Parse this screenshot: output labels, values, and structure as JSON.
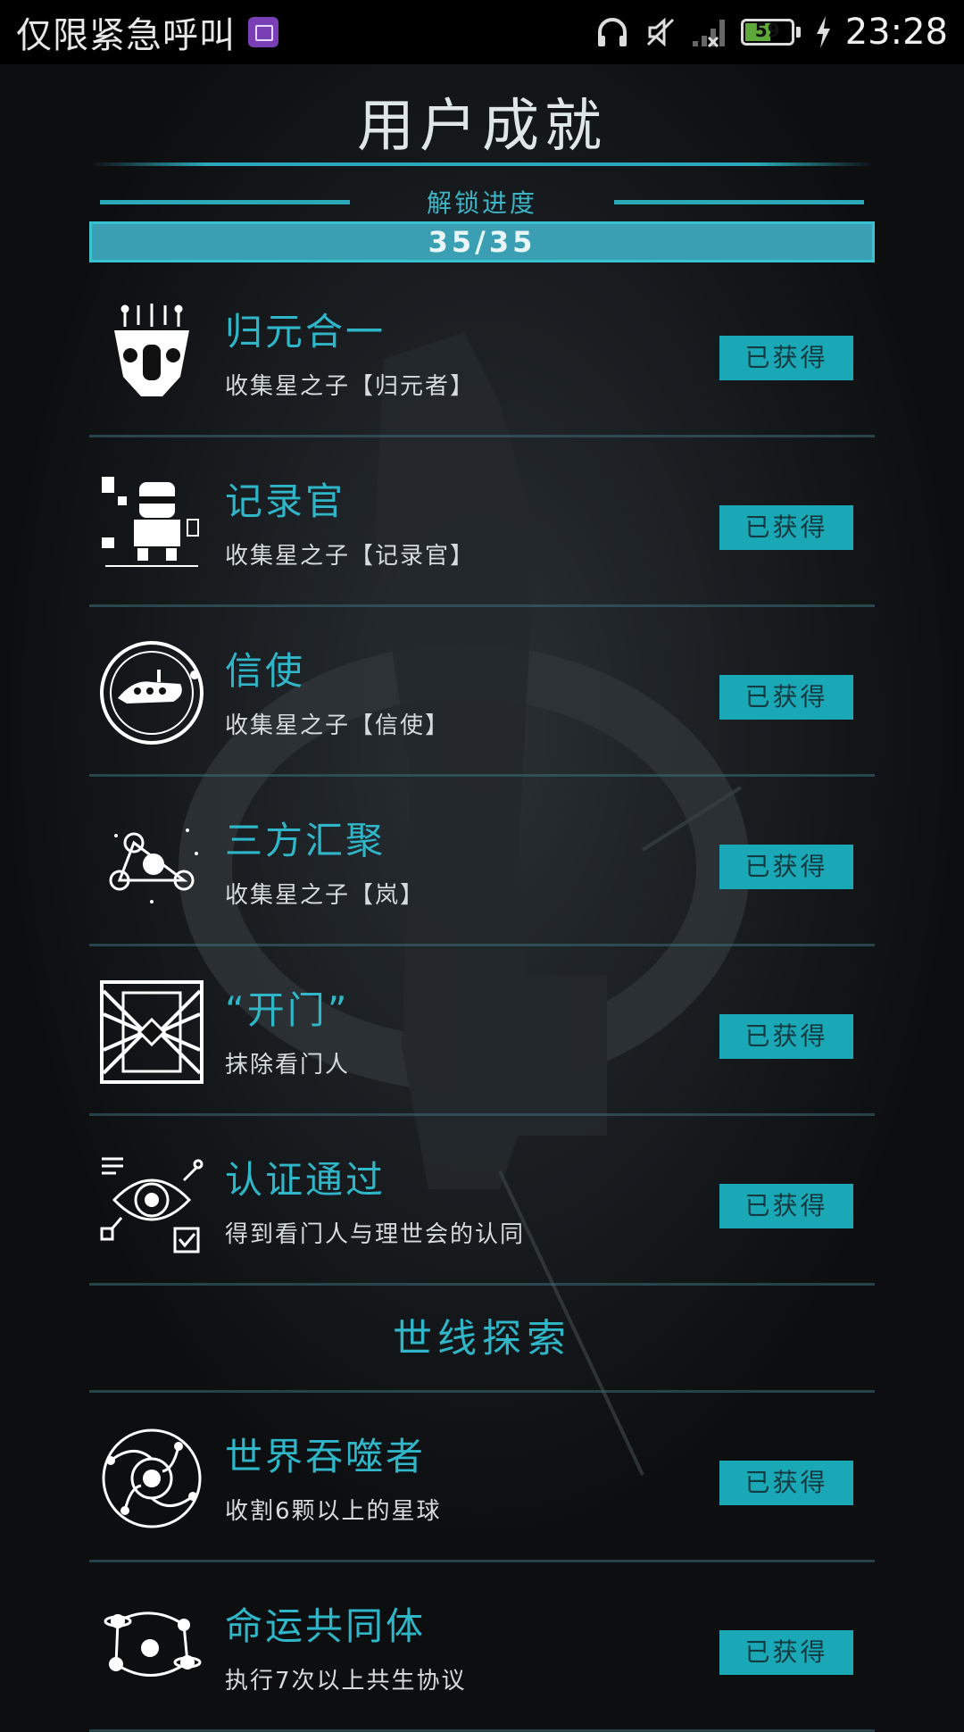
{
  "status_bar": {
    "carrier": "仅限紧急呼叫",
    "battery_level": "59",
    "battery_fraction": 0.59,
    "time": "23:28",
    "icons": [
      "gallery-icon",
      "headphones-icon",
      "mute-icon",
      "signal-icon",
      "battery-icon",
      "charging-icon"
    ]
  },
  "header": {
    "title": "用户成就",
    "progress_label": "解锁进度",
    "progress_text": "35/35",
    "progress_fraction": 1.0
  },
  "achievements": [
    {
      "name": "归元合一",
      "desc": "收集星之子【归元者】",
      "status": "已获得",
      "icon": "mask-icon"
    },
    {
      "name": "记录官",
      "desc": "收集星之子【记录官】",
      "status": "已获得",
      "icon": "robot-icon"
    },
    {
      "name": "信使",
      "desc": "收集星之子【信使】",
      "status": "已获得",
      "icon": "courier-icon"
    },
    {
      "name": "三方汇聚",
      "desc": "收集星之子【岚】",
      "status": "已获得",
      "icon": "triad-icon"
    },
    {
      "name": "“开门”",
      "desc": "抹除看门人",
      "status": "已获得",
      "icon": "gate-icon"
    },
    {
      "name": "认证通过",
      "desc": "得到看门人与理世会的认同",
      "status": "已获得",
      "icon": "eye-icon"
    }
  ],
  "section": {
    "title": "世线探索"
  },
  "exploration": [
    {
      "name": "世界吞噬者",
      "desc": "收割6颗以上的星球",
      "status": "已获得",
      "icon": "orbit-icon"
    },
    {
      "name": "命运共同体",
      "desc": "执行7次以上共生协议",
      "status": "已获得",
      "icon": "planets-icon"
    }
  ]
}
